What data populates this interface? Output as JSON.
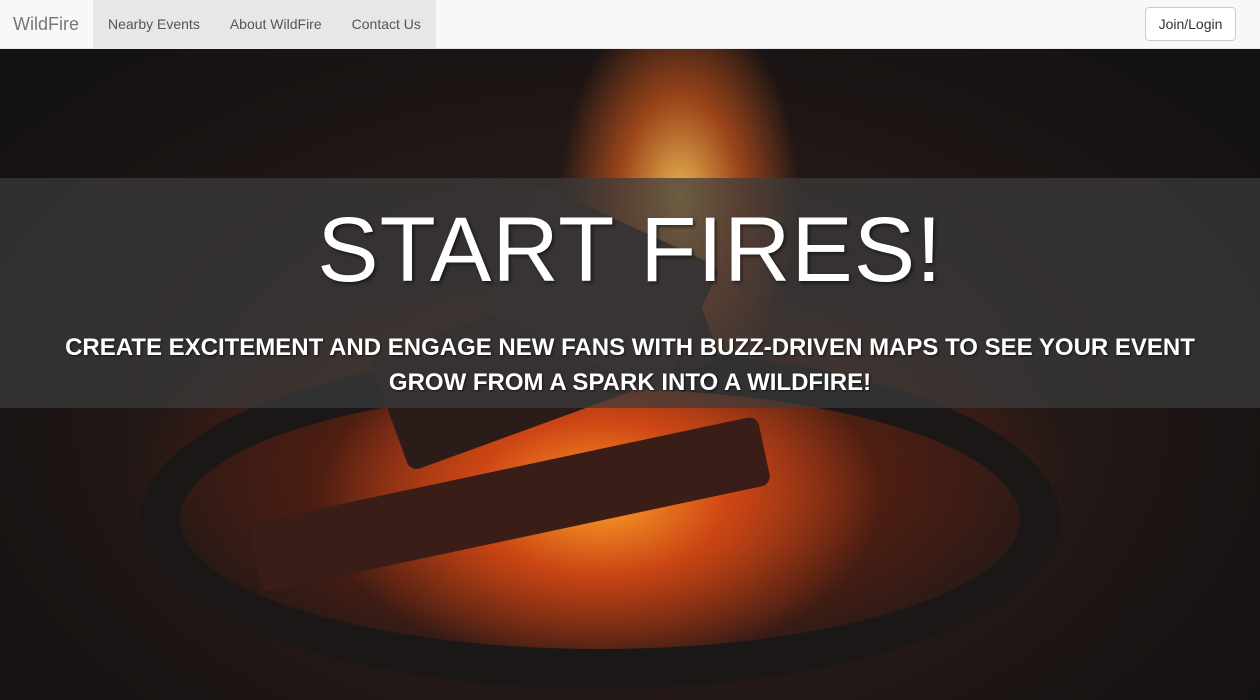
{
  "navbar": {
    "brand": "WildFire",
    "items": [
      {
        "label": "Nearby Events"
      },
      {
        "label": "About WildFire"
      },
      {
        "label": "Contact Us"
      }
    ],
    "join_label": "Join/Login"
  },
  "hero": {
    "headline": "START FIRES!",
    "subline": "CREATE EXCITEMENT AND ENGAGE NEW FANS WITH BUZZ-DRIVEN MAPS TO SEE YOUR EVENT GROW FROM A SPARK INTO A WILDFIRE!"
  }
}
